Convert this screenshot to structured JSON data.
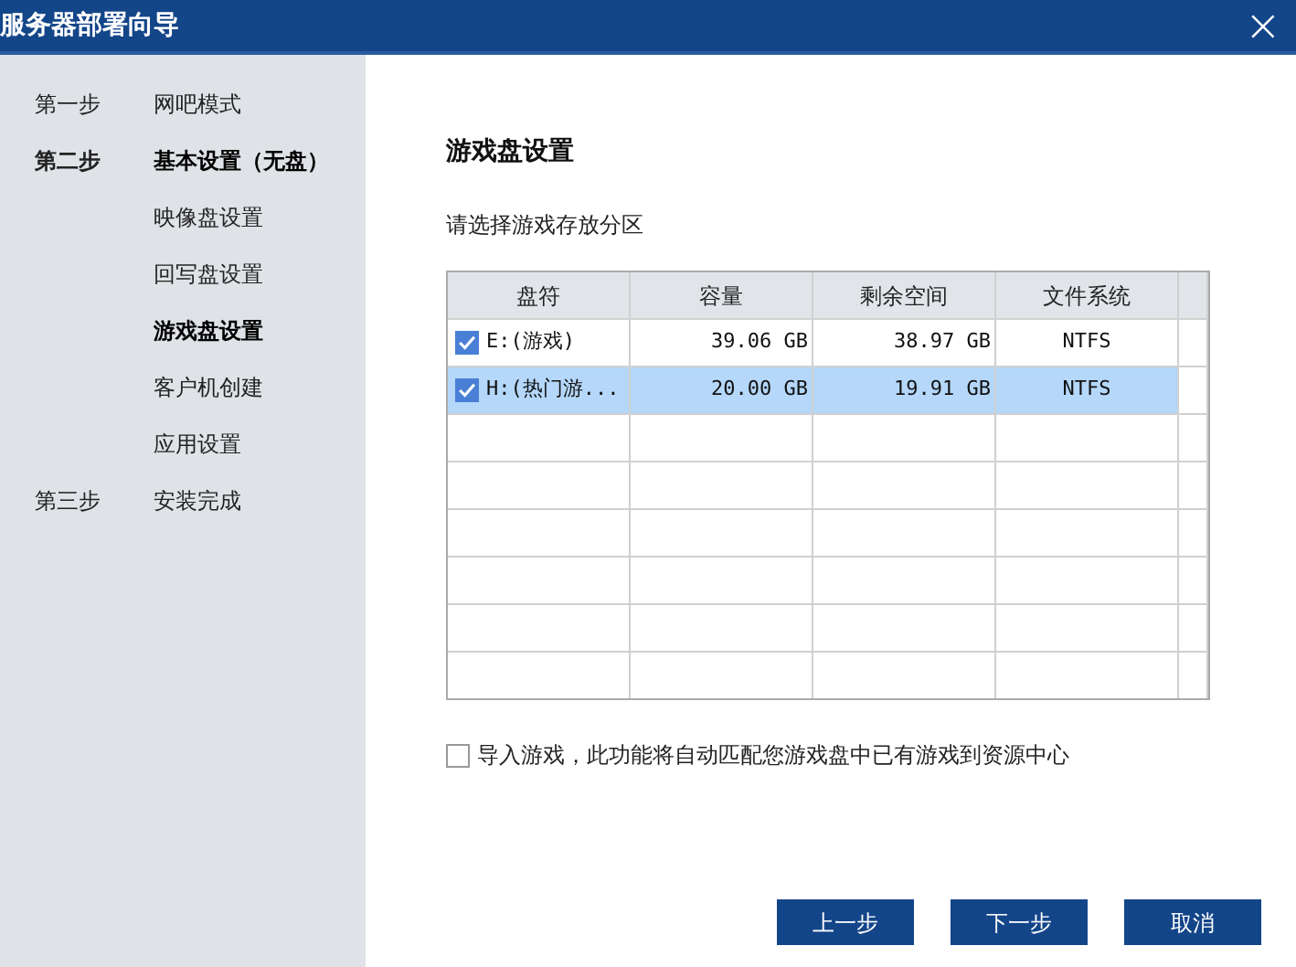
{
  "window": {
    "title": "服务器部署向导",
    "close": "×"
  },
  "sidebar": {
    "items": [
      {
        "step": "第一步",
        "label": "网吧模式",
        "selected": false
      },
      {
        "step": "第二步",
        "label": "基本设置（无盘）",
        "selected": true
      },
      {
        "label": "映像盘设置",
        "selected": false
      },
      {
        "label": "回写盘设置",
        "selected": false
      },
      {
        "label": "游戏盘设置",
        "selected": true
      },
      {
        "label": "客户机创建",
        "selected": false
      },
      {
        "label": "应用设置",
        "selected": false
      },
      {
        "step": "第三步",
        "label": "安装完成",
        "selected": false
      }
    ]
  },
  "heading": "游戏盘设置",
  "instruction": "请选择游戏存放分区",
  "table": {
    "columns": [
      "盘符",
      "容量",
      "剩余空间",
      "文件系统"
    ],
    "rows": [
      {
        "checked": true,
        "selected": false,
        "cells": [
          "E:(游戏)",
          "39.06 GB",
          "38.97 GB",
          "NTFS"
        ]
      },
      {
        "checked": true,
        "selected": true,
        "cells": [
          "H:(热门游...",
          "20.00 GB",
          "19.91 GB",
          "NTFS"
        ]
      }
    ]
  },
  "import_option": {
    "label": "导入游戏，此功能将自动匹配您游戏盘中已有游戏到资源中心",
    "checked": false
  },
  "buttons": [
    "上一步",
    "下一步",
    "取消"
  ]
}
